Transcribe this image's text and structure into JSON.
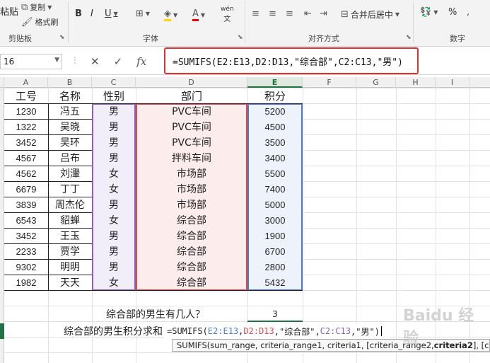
{
  "ribbon": {
    "clipboard": {
      "paste_partial": "粘贴",
      "copy": "复制",
      "format_painter": "格式刷",
      "label": "剪贴板"
    },
    "font": {
      "bold": "B",
      "italic": "I",
      "underline": "U",
      "wen": "wén",
      "label": "字体"
    },
    "align": {
      "merge": "合并后居中",
      "label": "对齐方式"
    },
    "number": {
      "label": "数字",
      "percent": "%"
    }
  },
  "formula_bar": {
    "name_box": "16",
    "cancel": "✕",
    "enter": "✓",
    "fx": "fx",
    "formula": "=SUMIFS(E2:E13,D2:D13,\"综合部\",C2:C13,\"男\")"
  },
  "columns": [
    "A",
    "B",
    "C",
    "D",
    "E",
    "F",
    "G",
    "H",
    "I"
  ],
  "selected_column": "E",
  "table": {
    "headers": [
      "工号",
      "名称",
      "性别",
      "部门",
      "积分"
    ],
    "rows": [
      [
        "1230",
        "冯五",
        "男",
        "PVC车间",
        "5200"
      ],
      [
        "1322",
        "吴晓",
        "男",
        "PVC车间",
        "4500"
      ],
      [
        "3452",
        "吴环",
        "男",
        "PVC车间",
        "3500"
      ],
      [
        "4567",
        "吕布",
        "男",
        "拌料车间",
        "3400"
      ],
      [
        "4562",
        "刘瀈",
        "女",
        "市场部",
        "5500"
      ],
      [
        "6679",
        "丁丁",
        "女",
        "市场部",
        "7400"
      ],
      [
        "3839",
        "周杰伦",
        "男",
        "市场部",
        "5000"
      ],
      [
        "6543",
        "貂蝉",
        "女",
        "综合部",
        "3000"
      ],
      [
        "3452",
        "王玉",
        "男",
        "综合部",
        "1900"
      ],
      [
        "2233",
        "贾学",
        "男",
        "综合部",
        "6700"
      ],
      [
        "9302",
        "明明",
        "男",
        "综合部",
        "2800"
      ],
      [
        "1982",
        "天天",
        "女",
        "综合部",
        "5432"
      ]
    ]
  },
  "question1": "综合部的男生有几人？",
  "answer1": "3",
  "question2": "综合部的男生积分求和",
  "edit_formula": {
    "prefix": "=SUMIFS(",
    "r1": "E2:E13",
    "c1": ",",
    "r2": "D2:D13",
    "mid": ",\"综合部\",",
    "r3": "C2:C13",
    "tail": ",\"男\")"
  },
  "tooltip": {
    "head": "SUMIFS(sum_range, criteria_range1, criteria1, [criteria_range2, ",
    "bold": "criteria2",
    "tail": "], [cri"
  },
  "watermark": "Baidu 经验",
  "colors": {
    "purple": "#8c5fbf",
    "red": "#d94a4a",
    "blue": "#4a7bd0",
    "excel_green": "#217346"
  }
}
